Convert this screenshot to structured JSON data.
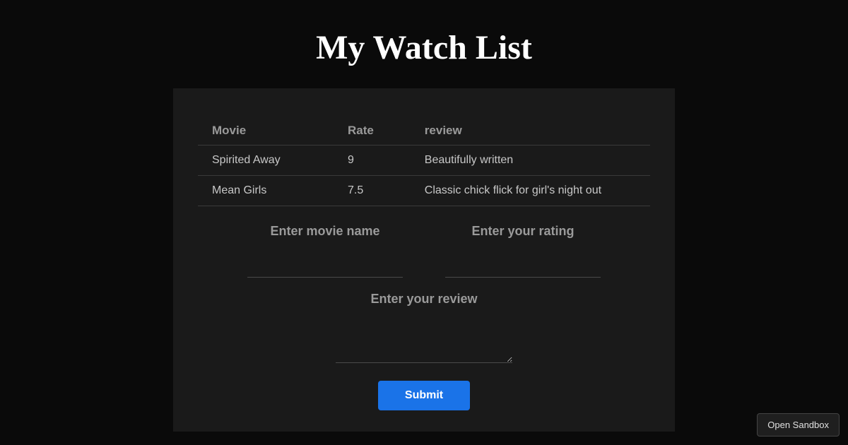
{
  "title": "My Watch List",
  "table": {
    "headers": {
      "movie": "Movie",
      "rate": "Rate",
      "review": "review"
    },
    "rows": [
      {
        "movie": "Spirited Away",
        "rate": "9",
        "review": "Beautifully written"
      },
      {
        "movie": "Mean Girls",
        "rate": "7.5",
        "review": "Classic chick flick for girl's night out"
      }
    ]
  },
  "form": {
    "movie_label": "Enter movie name",
    "rating_label": "Enter your rating",
    "review_label": "Enter your review",
    "submit_label": "Submit"
  },
  "sandbox": {
    "label": "Open Sandbox"
  }
}
